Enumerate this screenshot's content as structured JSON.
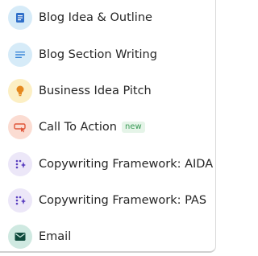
{
  "menu": {
    "items": [
      {
        "label": "Blog Idea & Outline",
        "icon": "document-icon",
        "icon_bg": "#d6ebf8",
        "icon_color": "#2f6fc9"
      },
      {
        "label": "Blog Section Writing",
        "icon": "text-lines-icon",
        "icon_bg": "#d6ebf8",
        "icon_color": "#3a86d8"
      },
      {
        "label": "Business Idea Pitch",
        "icon": "lightbulb-icon",
        "icon_bg": "#fcefc4",
        "icon_color": "#e5891f"
      },
      {
        "label": "Call To Action",
        "badge": "new",
        "icon": "button-cursor-icon",
        "icon_bg": "#fbdcd2",
        "icon_color": "#e0563a"
      },
      {
        "label": "Copywriting Framework: AIDA",
        "icon": "sparkle-dots-icon",
        "icon_bg": "#ece7f8",
        "icon_color": "#5a3fc0"
      },
      {
        "label": "Copywriting Framework: PAS",
        "icon": "sparkle-dots-icon",
        "icon_bg": "#ece7f8",
        "icon_color": "#5a3fc0"
      },
      {
        "label": "Email",
        "icon": "envelope-icon",
        "icon_bg": "#cfe9e1",
        "icon_color": "#0f4a3c"
      }
    ]
  }
}
